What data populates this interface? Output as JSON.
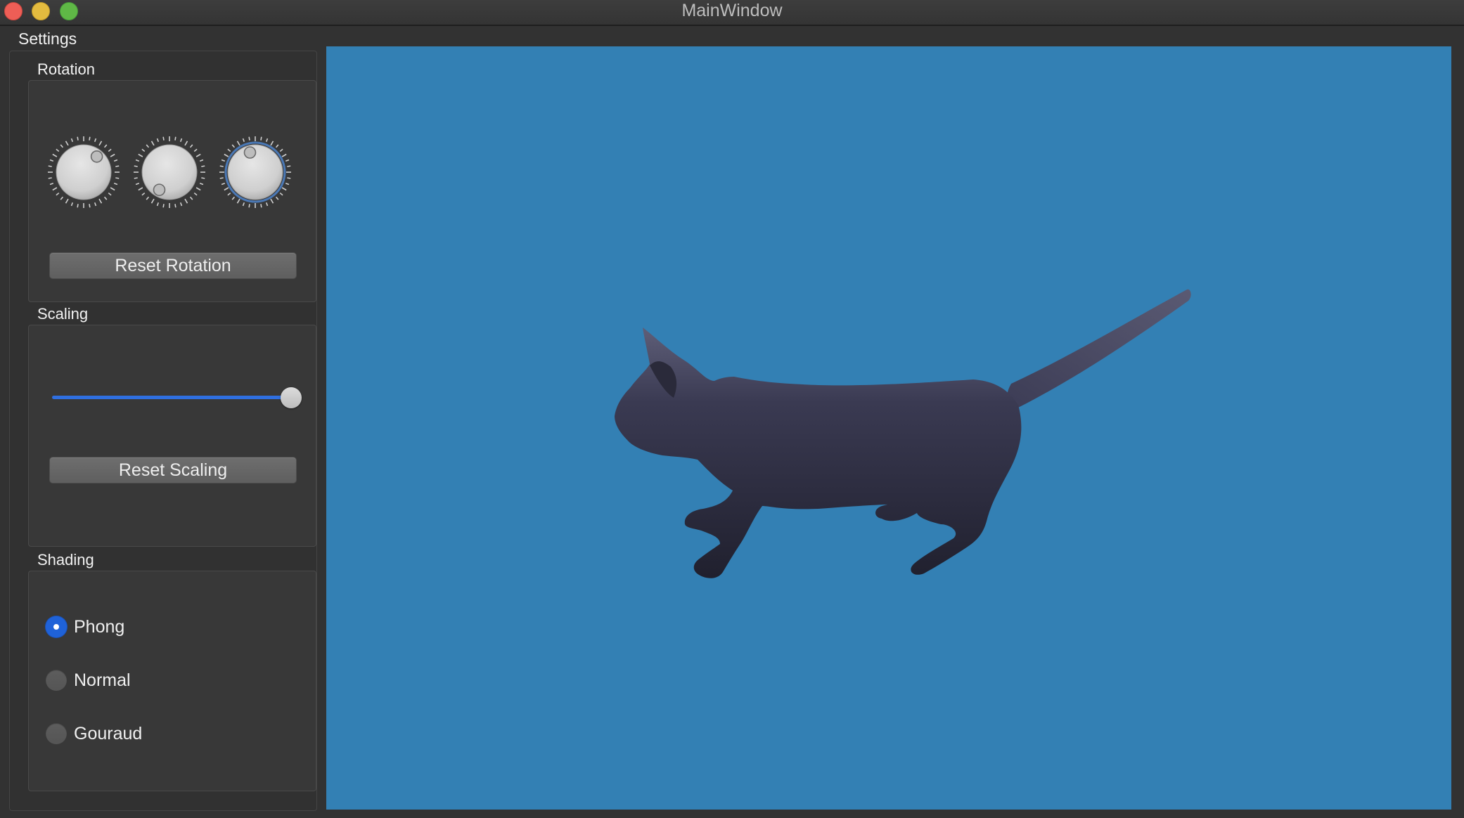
{
  "window": {
    "title": "MainWindow"
  },
  "dock": {
    "title": "Settings"
  },
  "rotation": {
    "title": "Rotation",
    "dials": [
      {
        "name": "rotation-x",
        "value_deg": 40
      },
      {
        "name": "rotation-y",
        "value_deg": 210
      },
      {
        "name": "rotation-z",
        "value_deg": -15,
        "focused": true
      }
    ],
    "reset_label": "Reset Rotation"
  },
  "scaling": {
    "title": "Scaling",
    "slider_value": 1.0,
    "reset_label": "Reset Scaling"
  },
  "shading": {
    "title": "Shading",
    "options": [
      {
        "label": "Phong",
        "checked": true
      },
      {
        "label": "Normal",
        "checked": false
      },
      {
        "label": "Gouraud",
        "checked": false
      }
    ]
  },
  "viewport": {
    "background_color": "#3380b4",
    "model": "cat",
    "model_color": "#26263a"
  },
  "colors": {
    "accent": "#2f6fe0",
    "window_bg": "#323232"
  }
}
